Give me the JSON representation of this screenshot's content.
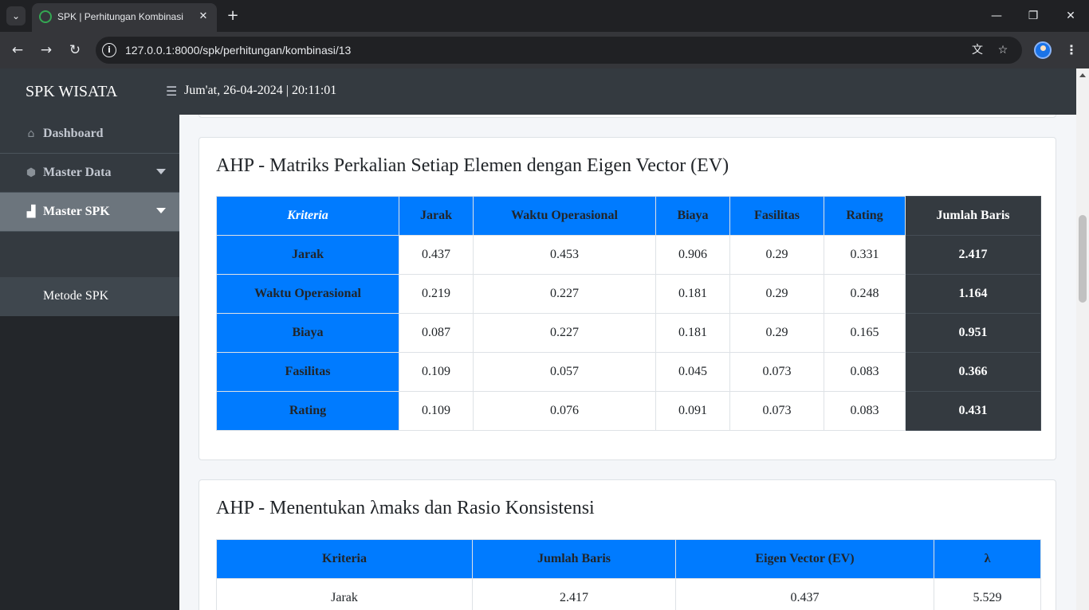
{
  "browser": {
    "tab_title": "SPK | Perhitungan Kombinasi",
    "url": "127.0.0.1:8000/spk/perhitungan/kombinasi/13"
  },
  "app": {
    "brand": "SPK WISATA",
    "datetime": "Jum'at, 26-04-2024 | 20:11:01"
  },
  "sidebar": {
    "items": [
      {
        "label": "Dashboard",
        "icon": "home-icon"
      },
      {
        "label": "Master Data",
        "icon": "cubes-icon"
      },
      {
        "label": "Master SPK",
        "icon": "sitemap-icon"
      }
    ],
    "sub_items": [
      {
        "label": "Metode SPK"
      }
    ]
  },
  "matrix_card": {
    "title": "AHP - Matriks Perkalian Setiap Elemen dengan Eigen Vector (EV)",
    "headers": [
      "Kriteria",
      "Jarak",
      "Waktu Operasional",
      "Biaya",
      "Fasilitas",
      "Rating",
      "Jumlah Baris"
    ],
    "rows": [
      {
        "name": "Jarak",
        "values": [
          "0.437",
          "0.453",
          "0.906",
          "0.29",
          "0.331"
        ],
        "total": "2.417"
      },
      {
        "name": "Waktu Operasional",
        "values": [
          "0.219",
          "0.227",
          "0.181",
          "0.29",
          "0.248"
        ],
        "total": "1.164"
      },
      {
        "name": "Biaya",
        "values": [
          "0.087",
          "0.227",
          "0.181",
          "0.29",
          "0.165"
        ],
        "total": "0.951"
      },
      {
        "name": "Fasilitas",
        "values": [
          "0.109",
          "0.057",
          "0.045",
          "0.073",
          "0.083"
        ],
        "total": "0.366"
      },
      {
        "name": "Rating",
        "values": [
          "0.109",
          "0.076",
          "0.091",
          "0.073",
          "0.083"
        ],
        "total": "0.431"
      }
    ]
  },
  "lambda_card": {
    "title": "AHP - Menentukan λmaks dan Rasio Konsistensi",
    "headers": [
      "Kriteria",
      "Jumlah Baris",
      "Eigen Vector (EV)",
      "λ"
    ],
    "rows": [
      {
        "values": [
          "Jarak",
          "2.417",
          "0.437",
          "5.529"
        ]
      }
    ]
  },
  "colors": {
    "primary": "#007bff",
    "dark": "#343a40",
    "sidebar_active": "#6c757d"
  }
}
